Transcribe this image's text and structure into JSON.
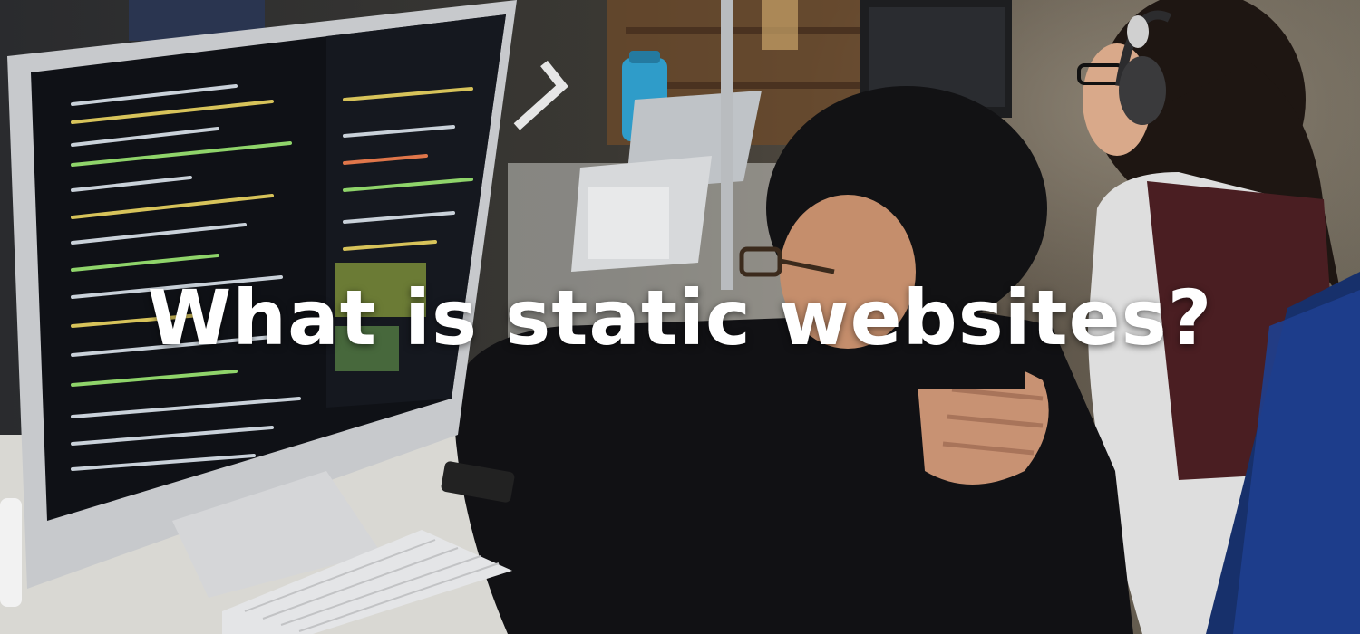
{
  "headline": "What is static websites?"
}
